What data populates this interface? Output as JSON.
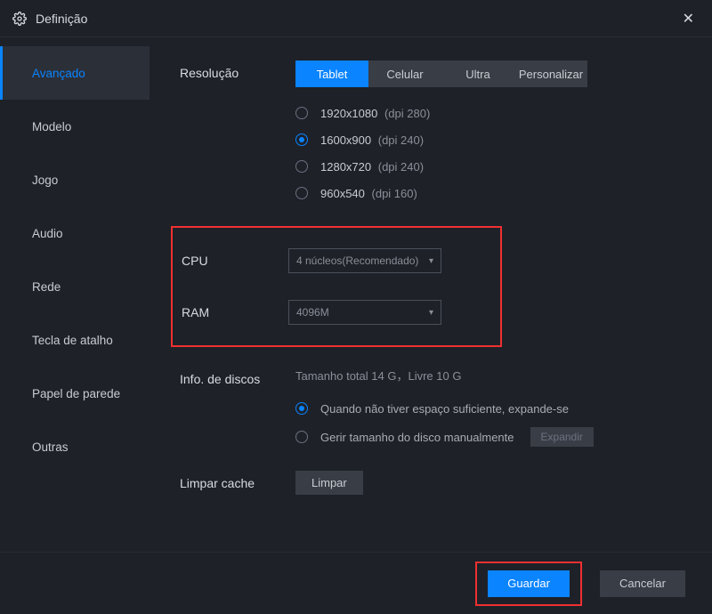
{
  "window": {
    "title": "Definição"
  },
  "sidebar": {
    "items": [
      {
        "label": "Avançado",
        "active": true
      },
      {
        "label": "Modelo"
      },
      {
        "label": "Jogo"
      },
      {
        "label": "Audio"
      },
      {
        "label": "Rede"
      },
      {
        "label": "Tecla de atalho"
      },
      {
        "label": "Papel de parede"
      },
      {
        "label": "Outras"
      }
    ]
  },
  "resolution": {
    "label": "Resolução",
    "tabs": [
      {
        "label": "Tablet",
        "active": true
      },
      {
        "label": "Celular"
      },
      {
        "label": "Ultra"
      },
      {
        "label": "Personalizar"
      }
    ],
    "options": [
      {
        "res": "1920x1080",
        "dpi": "(dpi 280)",
        "selected": false
      },
      {
        "res": "1600x900",
        "dpi": "(dpi 240)",
        "selected": true
      },
      {
        "res": "1280x720",
        "dpi": "(dpi 240)",
        "selected": false
      },
      {
        "res": "960x540",
        "dpi": "(dpi 160)",
        "selected": false
      }
    ]
  },
  "cpu": {
    "label": "CPU",
    "value": "4 núcleos(Recomendado)"
  },
  "ram": {
    "label": "RAM",
    "value": "4096M"
  },
  "disk": {
    "label": "Info. de discos",
    "summary": "Tamanho total 14 G，Livre 10 G",
    "options": [
      {
        "label": "Quando não tiver espaço suficiente, expande-se",
        "selected": true
      },
      {
        "label": "Gerir tamanho do disco manualmente",
        "selected": false
      }
    ],
    "expand_label": "Expandir"
  },
  "cache": {
    "label": "Limpar cache",
    "button": "Limpar"
  },
  "footer": {
    "save": "Guardar",
    "cancel": "Cancelar"
  }
}
